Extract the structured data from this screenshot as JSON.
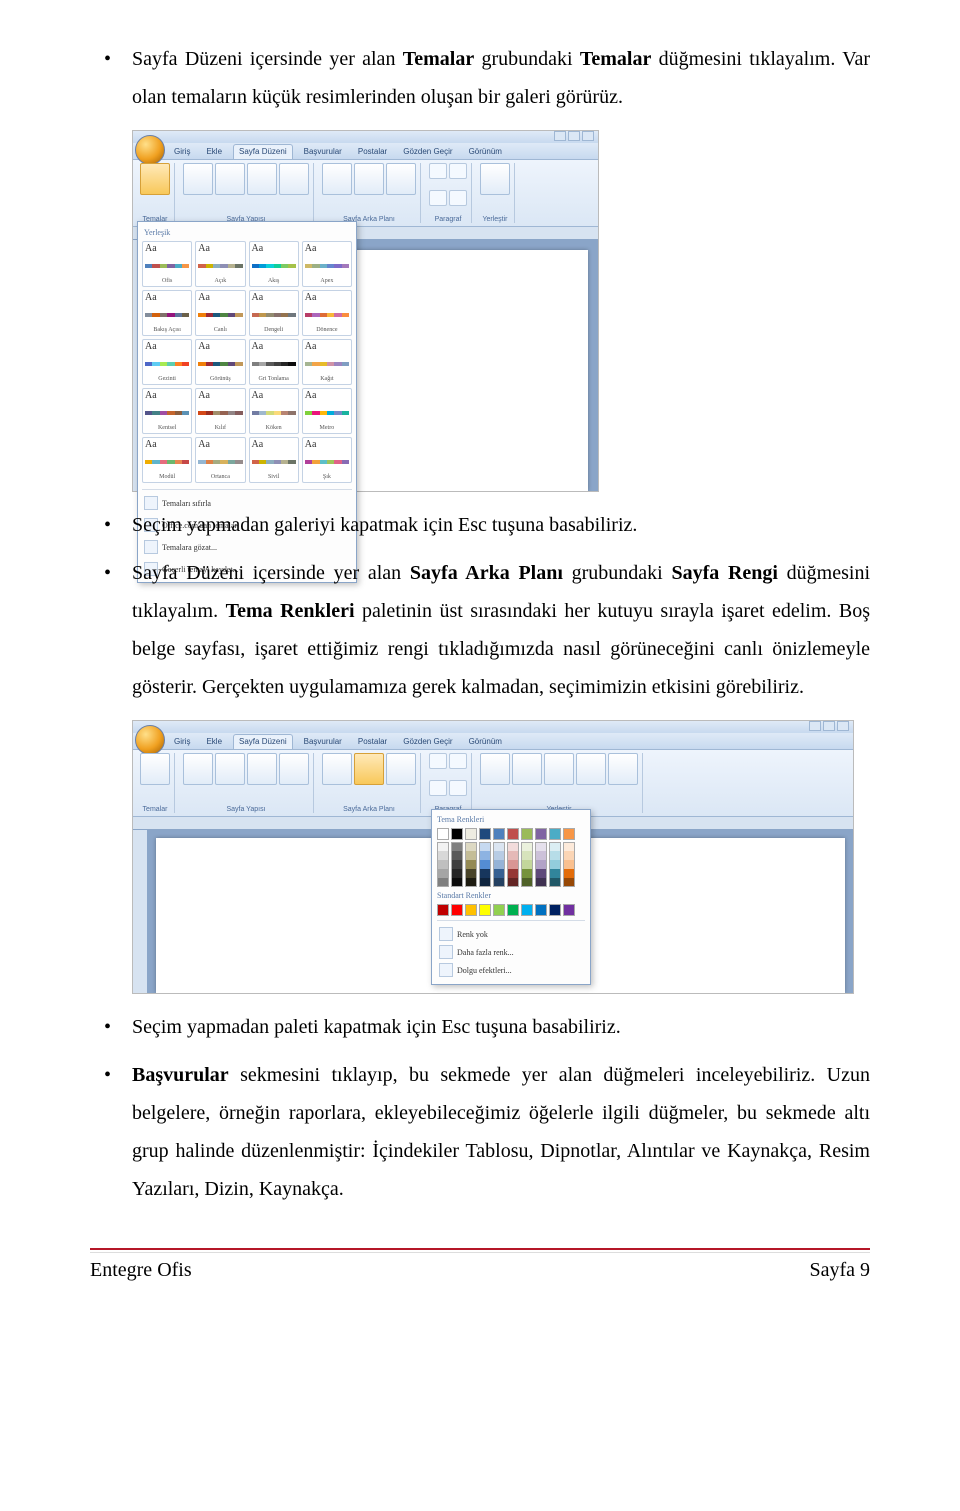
{
  "bullets": {
    "b1a": "Sayfa Düzeni içersinde yer alan ",
    "b1b": "Temalar",
    "b1c": " grubundaki ",
    "b1d": "Temalar",
    "b1e": " düğmesini tıklayalım. Var olan temaların küçük resimlerinden oluşan bir galeri görürüz.",
    "b2": "Seçim yapmadan galeriyi kapatmak için Esc tuşuna basabiliriz.",
    "b3a": "Sayfa Düzeni içersinde yer alan ",
    "b3b": "Sayfa Arka Planı",
    "b3c": " grubundaki ",
    "b3d": "Sayfa Rengi",
    "b3e": " düğmesini tıklayalım. ",
    "b3f": "Tema Renkleri",
    "b3g": " paletinin üst sırasındaki her kutuyu sırayla işaret edelim. Boş belge sayfası, işaret ettiğimiz rengi tıkladığımızda nasıl görüneceğini canlı önizlemeyle gösterir. Gerçekten uygulamamıza gerek kalmadan, seçimimizin etkisini görebiliriz.",
    "b4": "Seçim yapmadan paleti kapatmak için Esc tuşuna basabiliriz.",
    "b5a": "Başvurular",
    "b5b": " sekmesini tıklayıp, bu sekmede yer alan düğmeleri inceleyebiliriz. Uzun belgelere, örneğin raporlara, ekleyebileceğimiz öğelerle ilgili düğmeler, bu sekmede altı grup halinde düzenlenmiştir: İçindekiler Tablosu, Dipnotlar, Alıntılar ve Kaynakça, Resim Yazıları, Dizin, Kaynakça."
  },
  "word": {
    "tabs": [
      "Giriş",
      "Ekle",
      "Sayfa Düzeni",
      "Başvurular",
      "Postalar",
      "Gözden Geçir",
      "Görünüm"
    ],
    "themes": {
      "gallery_header": "Yerleşik",
      "items": [
        {
          "name": "Ofis",
          "c": [
            "#4f81bd",
            "#c0504d",
            "#9bbb59",
            "#8064a2",
            "#4bacc6",
            "#f79646"
          ]
        },
        {
          "name": "Açık",
          "c": [
            "#d16349",
            "#ccb400",
            "#8caebe",
            "#8e8fb5",
            "#b5b18f",
            "#6b7466"
          ]
        },
        {
          "name": "Akış",
          "c": [
            "#0f6fc6",
            "#009dd9",
            "#0bd0d9",
            "#10cf9b",
            "#7cca62",
            "#a5c249"
          ]
        },
        {
          "name": "Apex",
          "c": [
            "#ceb966",
            "#9cb084",
            "#6bb1c9",
            "#6585cf",
            "#7e6bc9",
            "#a379bb"
          ]
        },
        {
          "name": "Bakış Açısı",
          "c": [
            "#838d9b",
            "#d2610c",
            "#80716a",
            "#94147c",
            "#5d739a",
            "#6b6149"
          ]
        },
        {
          "name": "Canlı",
          "c": [
            "#f07f09",
            "#9f2936",
            "#1b587c",
            "#4e8542",
            "#604878",
            "#c19859"
          ]
        },
        {
          "name": "Dengeli",
          "c": [
            "#c66951",
            "#bf974d",
            "#928b70",
            "#87706b",
            "#94734e",
            "#6f777d"
          ]
        },
        {
          "name": "Dönence",
          "c": [
            "#b83d68",
            "#ac66bb",
            "#de6c36",
            "#f9b639",
            "#cf6da4",
            "#fa8d3d"
          ]
        },
        {
          "name": "Gezinti",
          "c": [
            "#4e67c8",
            "#5eccf3",
            "#a7ea52",
            "#5dceaf",
            "#ff8021",
            "#f14124"
          ]
        },
        {
          "name": "Görünüş",
          "c": [
            "#f07f09",
            "#9f2936",
            "#1b587c",
            "#4e8542",
            "#604878",
            "#c19859"
          ]
        },
        {
          "name": "Gri Tonlama",
          "c": [
            "#7f7f7f",
            "#a5a5a5",
            "#595959",
            "#404040",
            "#262626",
            "#0c0c0c"
          ]
        },
        {
          "name": "Kağıt",
          "c": [
            "#a5b592",
            "#f3a447",
            "#e7bc29",
            "#d092a7",
            "#9c85c0",
            "#809ec2"
          ]
        },
        {
          "name": "Kentsel",
          "c": [
            "#53548a",
            "#438086",
            "#a04da3",
            "#c4652d",
            "#8b5d3d",
            "#5c92b5"
          ]
        },
        {
          "name": "Kılıf",
          "c": [
            "#d34817",
            "#9b2d1f",
            "#a28e6a",
            "#956251",
            "#918485",
            "#855d5d"
          ]
        },
        {
          "name": "Köken",
          "c": [
            "#727ca3",
            "#9fb8cd",
            "#d2da7a",
            "#fada7a",
            "#b88472",
            "#8e736a"
          ]
        },
        {
          "name": "Metro",
          "c": [
            "#7fd13b",
            "#ea157a",
            "#feb80a",
            "#00addc",
            "#738ac8",
            "#1ab39f"
          ]
        },
        {
          "name": "Modül",
          "c": [
            "#f0ad00",
            "#60b5cc",
            "#e66c7d",
            "#6bb76d",
            "#e88651",
            "#c64847"
          ]
        },
        {
          "name": "Ortanca",
          "c": [
            "#94b6d2",
            "#dd8047",
            "#a5ab81",
            "#d8b25c",
            "#7ba79d",
            "#968c8c"
          ]
        },
        {
          "name": "Sivil",
          "c": [
            "#d16349",
            "#ccb400",
            "#8caebe",
            "#8e8fb5",
            "#b5b18f",
            "#6b7466"
          ]
        },
        {
          "name": "Şık",
          "c": [
            "#b13f9a",
            "#f2a13a",
            "#5dbfc8",
            "#9fc55a",
            "#e06287",
            "#886bb4"
          ]
        }
      ],
      "footer_opts": [
        "Temaları sıfırla",
        "Office.com'dan temalar",
        "Temalara gözat...",
        "Geçerli temayı kaydet..."
      ]
    },
    "pagecolor": {
      "header1": "Tema Renkleri",
      "theme_row": [
        "#ffffff",
        "#000000",
        "#eeece1",
        "#1f497d",
        "#4f81bd",
        "#c0504d",
        "#9bbb59",
        "#8064a2",
        "#4bacc6",
        "#f79646"
      ],
      "shades": [
        [
          "#f2f2f2",
          "#d8d8d8",
          "#bfbfbf",
          "#a5a5a5",
          "#7f7f7f"
        ],
        [
          "#7f7f7f",
          "#595959",
          "#3f3f3f",
          "#262626",
          "#0c0c0c"
        ],
        [
          "#ddd9c3",
          "#c4bd97",
          "#948a54",
          "#494429",
          "#1d1b10"
        ],
        [
          "#c6d9f0",
          "#8db3e2",
          "#548dd4",
          "#17365d",
          "#0f243e"
        ],
        [
          "#dbe5f1",
          "#b8cce4",
          "#95b3d7",
          "#366092",
          "#244061"
        ],
        [
          "#f2dcdb",
          "#e5b9b7",
          "#d99694",
          "#953734",
          "#632423"
        ],
        [
          "#ebf1dd",
          "#d7e3bc",
          "#c3d69b",
          "#76923c",
          "#4f6128"
        ],
        [
          "#e5e0ec",
          "#ccc1d9",
          "#b2a2c7",
          "#5f497a",
          "#3f3151"
        ],
        [
          "#dbeef3",
          "#b7dde8",
          "#92cddc",
          "#31859b",
          "#205867"
        ],
        [
          "#fdeada",
          "#fbd5b5",
          "#fac08f",
          "#e36c09",
          "#974806"
        ]
      ],
      "header2": "Standart Renkler",
      "std_row": [
        "#c00000",
        "#ff0000",
        "#ffc000",
        "#ffff00",
        "#92d050",
        "#00b050",
        "#00b0f0",
        "#0070c0",
        "#002060",
        "#7030a0"
      ],
      "opts": [
        "Renk yok",
        "Daha fazla renk...",
        "Dolgu efektleri..."
      ]
    }
  },
  "footer": {
    "left": "Entegre Ofis",
    "right": "Sayfa 9"
  }
}
